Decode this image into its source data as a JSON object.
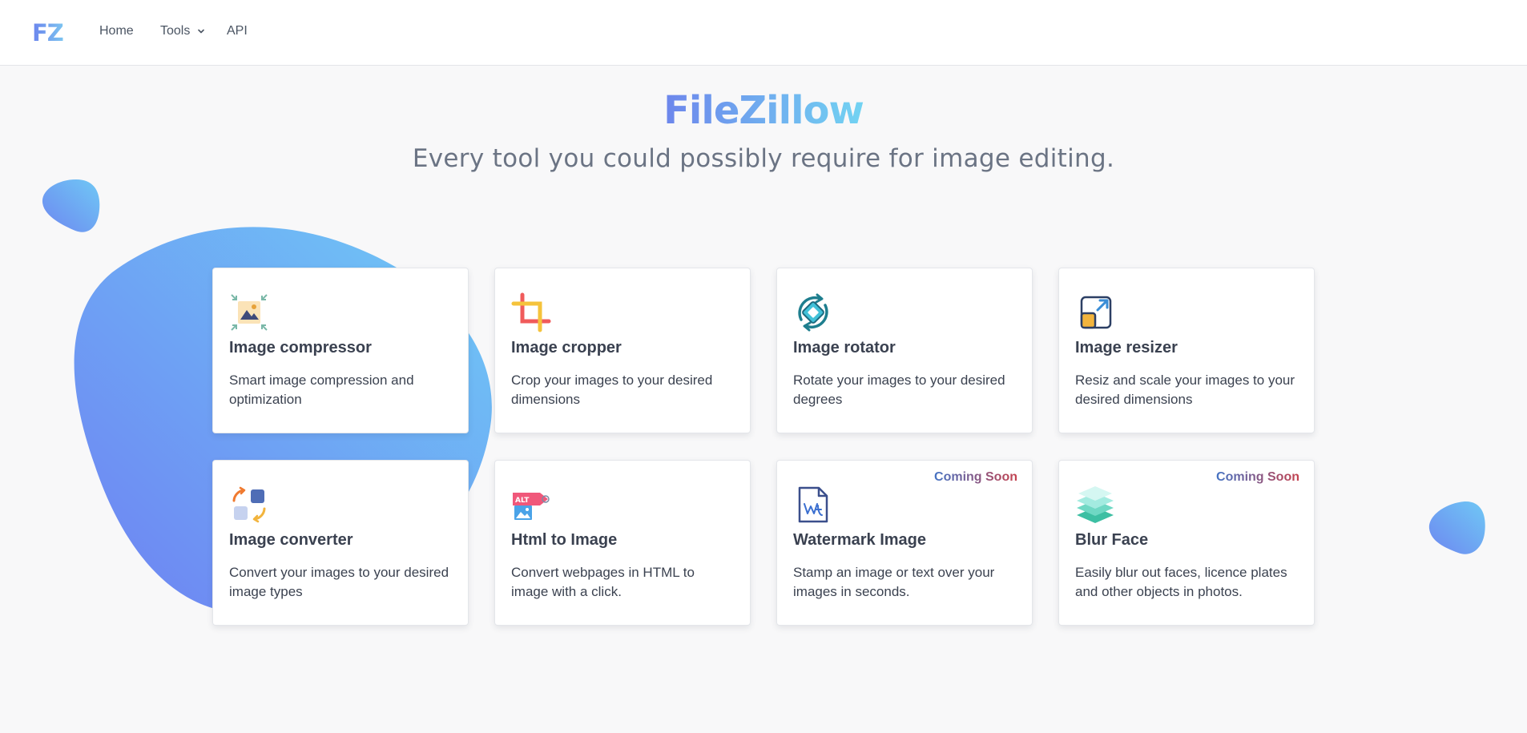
{
  "nav": {
    "logo": "FZ",
    "links": [
      {
        "label": "Home"
      },
      {
        "label": "Tools"
      },
      {
        "label": "API"
      }
    ]
  },
  "hero": {
    "title": "FileZillow",
    "subtitle": "Every tool you could possibly require for image editing."
  },
  "colors": {
    "brand_start": "#6d86ec",
    "brand_end": "#72d3f2",
    "blob_start": "#6e87f0",
    "blob_end": "#6fc8f5",
    "coming_soon_start": "#4674c4",
    "coming_soon_end": "#c5424e"
  },
  "tools": [
    {
      "title": "Image compressor",
      "description": "Smart image compression and optimization",
      "icon": "image-compress-icon",
      "badge": ""
    },
    {
      "title": "Image cropper",
      "description": "Crop your images to your desired dimensions",
      "icon": "crop-icon",
      "badge": ""
    },
    {
      "title": "Image rotator",
      "description": "Rotate your images to your desired degrees",
      "icon": "rotate-icon",
      "badge": ""
    },
    {
      "title": "Image resizer",
      "description": "Resiz and scale your images to your desired dimensions",
      "icon": "resize-icon",
      "badge": ""
    },
    {
      "title": "Image converter",
      "description": "Convert your images to your desired image types",
      "icon": "convert-icon",
      "badge": ""
    },
    {
      "title": "Html to Image",
      "description": "Convert webpages in HTML to image with a click.",
      "icon": "alt-tag-icon",
      "badge": ""
    },
    {
      "title": "Watermark Image",
      "description": "Stamp an image or text over your images in seconds.",
      "icon": "watermark-icon",
      "badge": "Coming Soon"
    },
    {
      "title": "Blur Face",
      "description": "Easily blur out faces, licence plates and other objects in photos.",
      "icon": "layers-icon",
      "badge": "Coming Soon"
    }
  ]
}
